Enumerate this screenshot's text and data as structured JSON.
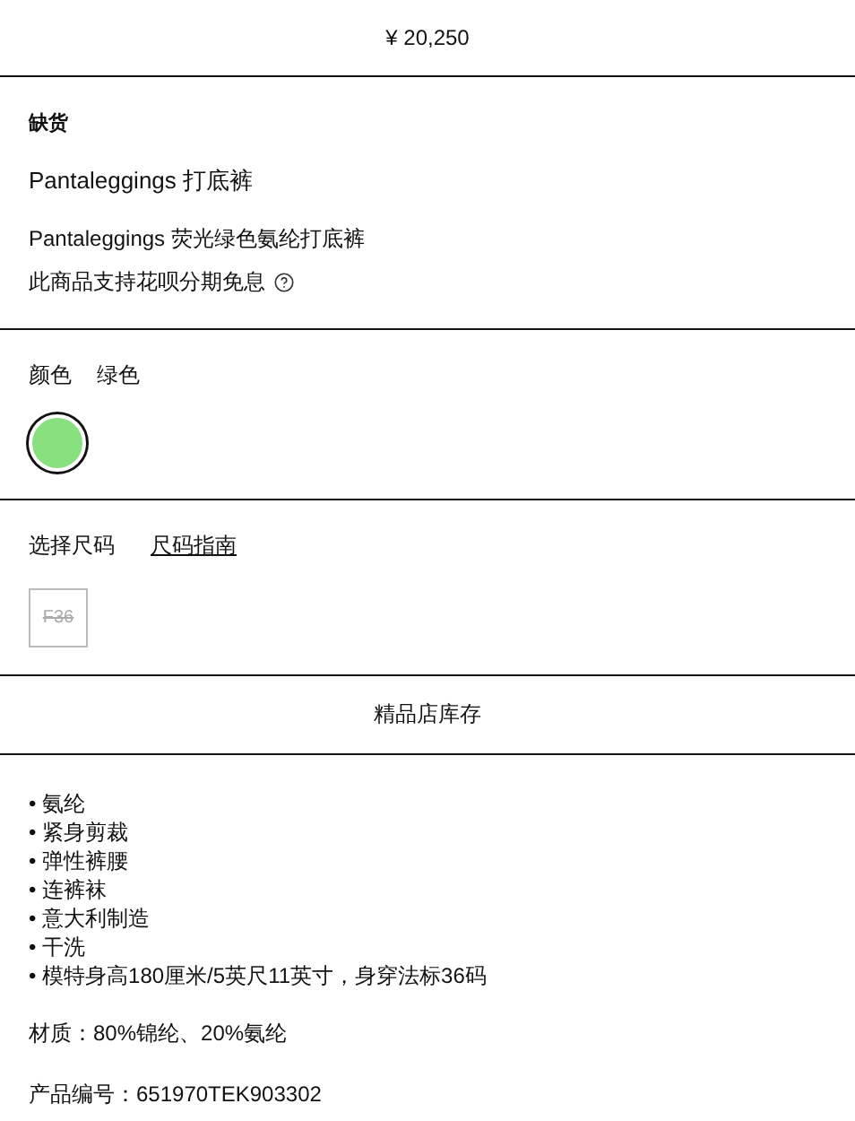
{
  "price": "¥ 20,250",
  "stock_status": "缺货",
  "product_title": "Pantaleggings 打底裤",
  "product_subtitle": "Pantaleggings 荧光绿色氨纶打底裤",
  "installment_note": "此商品支持花呗分期免息",
  "color": {
    "label": "颜色",
    "value": "绿色",
    "swatches": [
      {
        "color": "#88e07e",
        "selected": true
      }
    ]
  },
  "size": {
    "label": "选择尺码",
    "guide_link": "尺码指南",
    "options": [
      {
        "label": "F36",
        "disabled": true
      }
    ]
  },
  "boutique_button": "精品店库存",
  "features": [
    {
      "text": "• 氨纶"
    },
    {
      "text": "• 紧身剪裁"
    },
    {
      "text": "• 弹性裤腰"
    },
    {
      "text": "• 连裤袜"
    },
    {
      "text": "• 意大利制造"
    },
    {
      "text": "• 干洗"
    },
    {
      "text": "• 模特身高180厘米/5英尺11英寸，身穿法标36码"
    }
  ],
  "material": "材质：80%锦纶、20%氨纶",
  "product_code": "产品编号：651970TEK903302"
}
